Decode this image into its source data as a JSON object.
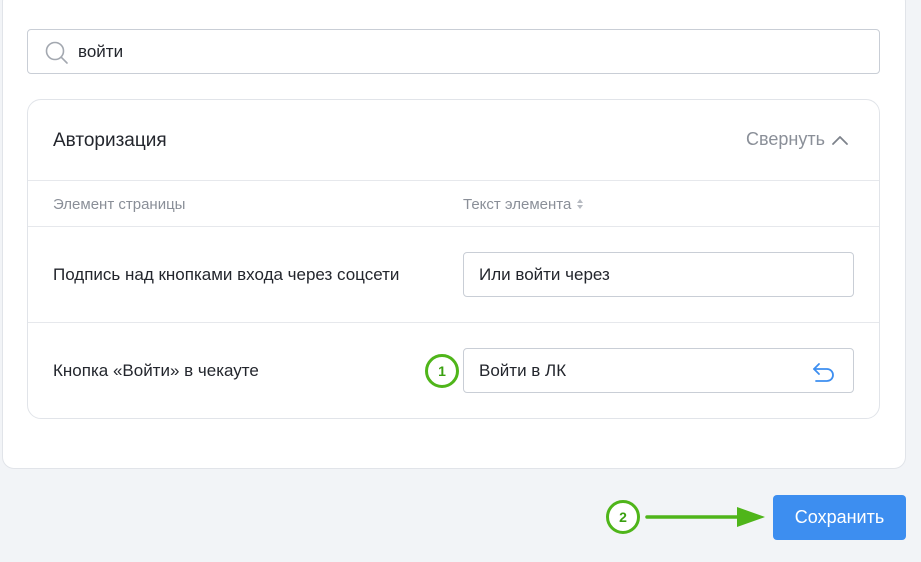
{
  "search": {
    "value": "войти"
  },
  "section": {
    "title": "Авторизация",
    "collapse_label": "Свернуть",
    "columns": {
      "element": "Элемент страницы",
      "text": "Текст элемента"
    },
    "rows": [
      {
        "label": "Подпись над кнопками входа через соцсети",
        "value": "Или войти через"
      },
      {
        "label": "Кнопка «Войти» в чекауте",
        "value": "Войти в ЛК"
      }
    ]
  },
  "annotations": {
    "marker_1": "1",
    "marker_2": "2"
  },
  "footer": {
    "save_label": "Сохранить"
  },
  "colors": {
    "accent": "#3d8ef0",
    "annotation_green": "#4fb51a",
    "muted_text": "#8a8f98",
    "border": "#c9ced6"
  },
  "icons": [
    "search-icon",
    "chevron-up-icon",
    "sort-icon",
    "undo-icon",
    "arrow-right-icon"
  ]
}
